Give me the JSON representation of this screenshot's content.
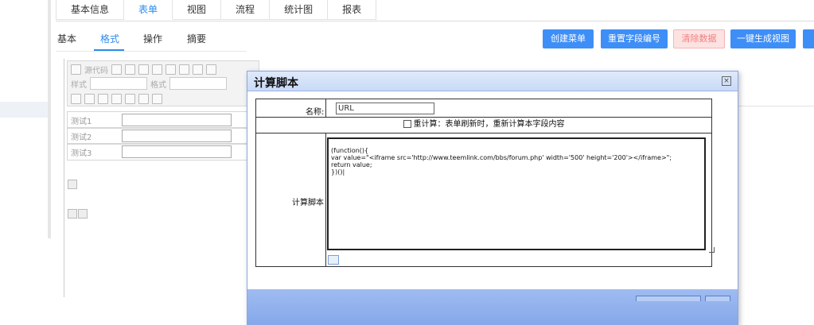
{
  "top_tabs": [
    "基本信息",
    "表单",
    "视图",
    "流程",
    "统计图",
    "报表"
  ],
  "sub_tabs": [
    "基本",
    "格式",
    "操作",
    "摘要"
  ],
  "actions": {
    "create_menu": "创建菜单",
    "renumber_fields": "重置字段编号",
    "clear_data": "清除数据",
    "generate_view": "一键生成视图"
  },
  "toolbar": {
    "source_label": "源代码",
    "style_label": "样式",
    "format_label": "格式"
  },
  "form_fields": [
    "测试1",
    "测试2",
    "测试3"
  ],
  "dialog": {
    "title": "计算脚本",
    "name_label": "名称:",
    "name_value": "URL",
    "recalc_label": "重计算：表单刷新时，重新计算本字段内容",
    "script_label": "计算脚本",
    "script_code": "(function(){\nvar value=\"<iframe src='http://www.teemlink.com/bbs/forum.php' width='500' height='200'></iframe>\";\nreturn value;\n})()|"
  },
  "colors": {
    "accent": "#2d8cf0",
    "button": "#3e8ef7",
    "danger_bg": "#fde2e2",
    "dialog_header": "#c9daf7"
  }
}
